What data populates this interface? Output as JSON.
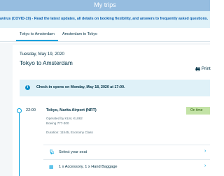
{
  "header": {
    "title": "My trips"
  },
  "notice": {
    "text": "avirus (COVID-19) - Read the latest updates, all details on booking flexibility, and answers to frequently asked questions."
  },
  "tabs": [
    {
      "label": "Tokyo to Amsterdam",
      "active": true
    },
    {
      "label": "Amsterdam to Tokyo",
      "active": false
    }
  ],
  "trip": {
    "date": "Tuesday, May 19, 2020",
    "route": "Tokyo to Amsterdam",
    "print_label": "Print"
  },
  "checkin": {
    "text": "Check-in opens on Monday, May 18, 2020 at 17:00."
  },
  "flight": {
    "time": "22:00",
    "airport": "Tokyo, Narita Airport (NRT)",
    "status": "On time",
    "operated_by": "Operated by KLM, KL862",
    "aircraft": "Boeing 777-300",
    "duration": "Duration: 11h45, Economy Class"
  },
  "options": [
    {
      "label": "Select your seat",
      "icon": "seat-icon"
    },
    {
      "label": "1 x Accessory, 1 x Hand Baggage",
      "icon": "baggage-icon"
    }
  ],
  "colors": {
    "header": "#96bde0",
    "accent": "#00a1de",
    "notice_bg": "#dff1f8",
    "status_bg": "#c3e3a6"
  }
}
